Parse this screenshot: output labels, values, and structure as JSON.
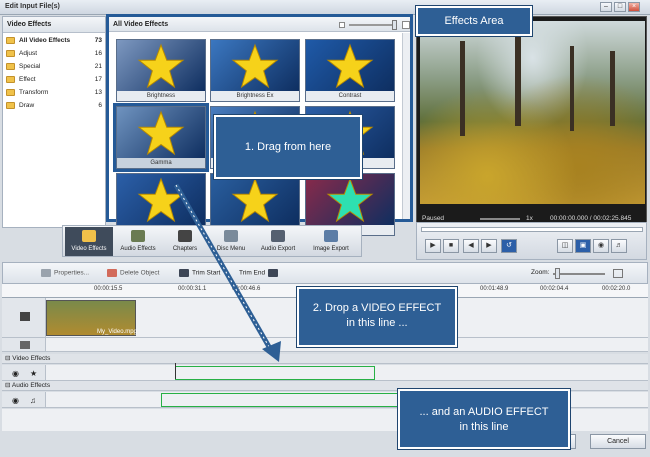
{
  "window": {
    "title": "Edit Input File(s)"
  },
  "left_panel": {
    "header": "Video Effects",
    "categories": [
      {
        "name": "All Video Effects",
        "count": "73"
      },
      {
        "name": "Adjust",
        "count": "16"
      },
      {
        "name": "Special",
        "count": "21"
      },
      {
        "name": "Effect",
        "count": "17"
      },
      {
        "name": "Transform",
        "count": "13"
      },
      {
        "name": "Draw",
        "count": "6"
      }
    ]
  },
  "effects_panel": {
    "header": "All Video Effects",
    "tiles": [
      {
        "label": "Brightness",
        "color": "#7d98c0"
      },
      {
        "label": "Brightness Ex",
        "color": "#3b77c0"
      },
      {
        "label": "Contrast",
        "color": "#1f5aa8"
      },
      {
        "label": "Gamma",
        "color": "#6f93bf"
      },
      {
        "label": "",
        "color": "#4a7ec0"
      },
      {
        "label": "",
        "color": "#2b5ea6"
      },
      {
        "label": "",
        "color": "#2b5fa8"
      },
      {
        "label": "",
        "color": "#2a5f9f"
      },
      {
        "label": "",
        "color": "#8a2a4a"
      }
    ]
  },
  "preview": {
    "status": "Paused",
    "speed": "1x",
    "time": "00:00:00.000 / 00:02:25.845"
  },
  "tabs": [
    {
      "label": "Video Effects"
    },
    {
      "label": "Audio Effects"
    },
    {
      "label": "Chapters"
    },
    {
      "label": "Disc Menu"
    },
    {
      "label": "Audio Export"
    },
    {
      "label": "Image Export"
    }
  ],
  "timeline_toolbar": {
    "properties": "Properties...",
    "delete": "Delete Object",
    "trim_start": "Trim Start",
    "trim_end": "Trim End",
    "zoom": "Zoom:"
  },
  "ruler": {
    "ticks": [
      "00:00:15.5",
      "00:00:31.1",
      "00:00:46.6",
      "00:01:48.9",
      "00:02:04.4",
      "00:02:20.0"
    ]
  },
  "tracks": {
    "clip_name": "My_Video.mpg",
    "video_effects_label": "Video Effects",
    "audio_effects_label": "Audio Effects"
  },
  "callouts": {
    "effects_area": "Effects Area",
    "drag": "1. Drag from here",
    "drop_video": "2. Drop a VIDEO EFFECT in this line ...",
    "drop_audio": "... and an AUDIO EFFECT in this line"
  },
  "buttons": {
    "cancel": "Cancel"
  },
  "colors": {
    "accent": "#2e5f95",
    "highlight": "#27b045"
  }
}
